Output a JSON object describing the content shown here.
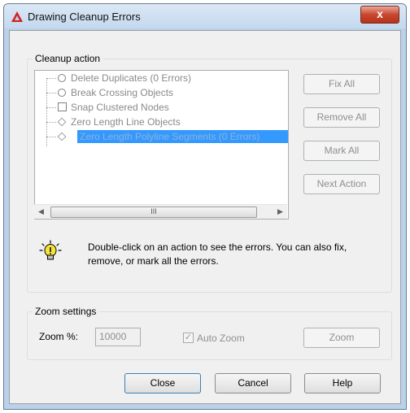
{
  "window": {
    "title": "Drawing Cleanup Errors",
    "close_glyph": "x"
  },
  "cleanup": {
    "group_label": "Cleanup action",
    "items": [
      {
        "label": "Delete Duplicates (0 Errors)",
        "icon": "circle"
      },
      {
        "label": "Break Crossing Objects",
        "icon": "circle"
      },
      {
        "label": "Snap Clustered Nodes",
        "icon": "square"
      },
      {
        "label": "Zero Length Line Objects",
        "icon": "diamond"
      },
      {
        "label": "Zero Length Polyline Segments (0 Errors)",
        "icon": "diamond",
        "selected": true
      }
    ],
    "scroll": {
      "left": "◀",
      "right": "▶",
      "thumb": "III"
    },
    "buttons": {
      "fix_all": "Fix All",
      "remove_all": "Remove All",
      "mark_all": "Mark All",
      "next_action": "Next Action"
    },
    "info_text": "Double-click on an action to see the errors. You can also fix, remove, or mark all the errors."
  },
  "zoom": {
    "group_label": "Zoom settings",
    "zoom_label": "Zoom %:",
    "zoom_value": "10000",
    "auto_zoom_label": "Auto Zoom",
    "auto_zoom_checked": true,
    "check_glyph": "✓",
    "zoom_button": "Zoom"
  },
  "footer": {
    "close": "Close",
    "cancel": "Cancel",
    "help": "Help"
  },
  "colors": {
    "selection": "#3399ff",
    "title_close": "#c8472f",
    "app_icon": "#d42020",
    "bulb": "#f7e43a"
  }
}
